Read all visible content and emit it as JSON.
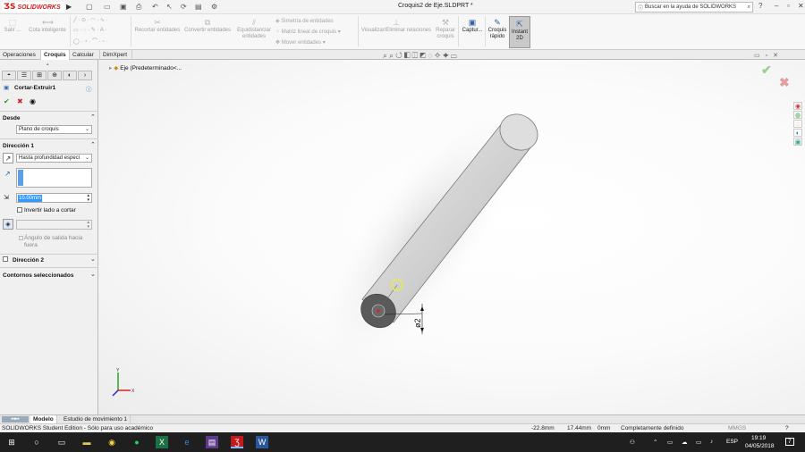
{
  "app": {
    "name": "SOLIDWORKS",
    "doc_title": "Croquis2 de Eje.SLDPRT *",
    "help_placeholder": "Buscar en la ayuda de SOLIDWORKS"
  },
  "ribbon": {
    "salir": "Salir ...",
    "cota_inteligente": "Cota inteligente",
    "recortar_entidades": "Recortar entidades",
    "convertir_entidades": "Convertir entidades",
    "equidistanciar": "Equidistanciar entidades",
    "simetria": "Simetría de entidades",
    "matriz_lineal": "Matriz lineal de croquis",
    "mover_entidades": "Mover entidades",
    "visualizar_relaciones": "Visualizar/Eliminar relaciones",
    "reparar_croquis": "Reparar croquis",
    "captura": "Captur...",
    "croquis_rapido": "Croquis rápido",
    "instant2d": "Instant 2D"
  },
  "tabs": [
    "Operaciones",
    "Croquis",
    "Calcular",
    "DimXpert"
  ],
  "active_tab": "Croquis",
  "property_manager": {
    "title": "Cortar-Extruir1",
    "desde_label": "Desde",
    "desde_value": "Plano de croquis",
    "direccion1_label": "Dirección 1",
    "direccion1_value": "Hasta profundidad especi",
    "depth_value": "10.00mm",
    "invertir_label": "Invertir lado a cortar",
    "angulo_label": "Ángulo de salida hacia fuera",
    "direccion2_label": "Dirección 2",
    "contornos_label": "Contornos seleccionados"
  },
  "tree": {
    "item": "Eje (Predeterminado<..."
  },
  "dimension": {
    "text": "ø2"
  },
  "bottom_tabs": [
    "Modelo",
    "Estudio de movimiento 1"
  ],
  "status": {
    "edition": "SOLIDWORKS Student Edition - Sólo para uso académico",
    "x": "-22.8mm",
    "y": "17.44mm",
    "z": "0mm",
    "state": "Completamente definido",
    "units": "MMGS"
  },
  "taskbar": {
    "lang": "ESP",
    "time": "19:19",
    "date": "04/05/2018",
    "notif": "7"
  }
}
